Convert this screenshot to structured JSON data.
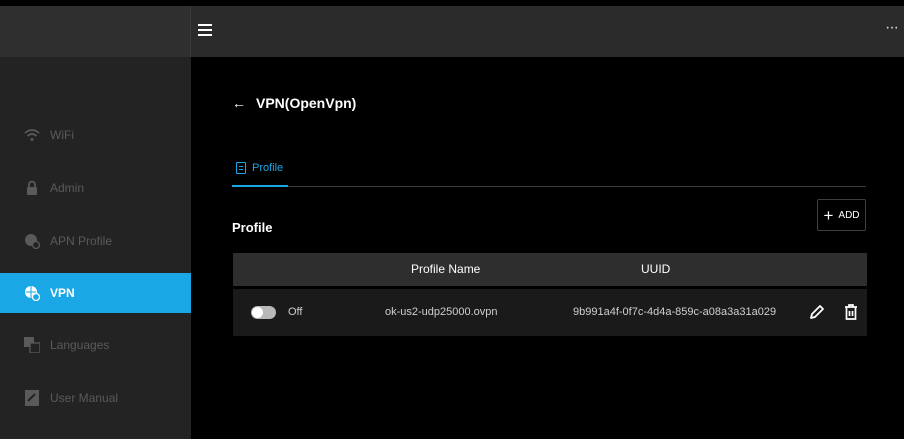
{
  "topbar": {
    "menu_icon": "hamburger-menu-icon",
    "more_icon": "more-options-icon",
    "more_glyph": "···"
  },
  "sidebar": {
    "items": [
      {
        "label": "WiFi",
        "icon": "wifi-icon"
      },
      {
        "label": "Admin",
        "icon": "lock-icon"
      },
      {
        "label": "APN Profile",
        "icon": "apn-profile-icon"
      },
      {
        "label": "VPN",
        "icon": "vpn-icon",
        "active": true
      },
      {
        "label": "Languages",
        "icon": "languages-icon"
      },
      {
        "label": "User Manual",
        "icon": "user-manual-icon"
      }
    ]
  },
  "page": {
    "back_glyph": "←",
    "title": "VPN(OpenVpn)"
  },
  "tabs": [
    {
      "label": "Profile",
      "icon": "document-icon",
      "active": true
    }
  ],
  "section": {
    "title": "Profile",
    "add_label": "ADD",
    "add_glyph": "+"
  },
  "table": {
    "headers": [
      "",
      "Profile Name",
      "UUID",
      ""
    ],
    "rows": [
      {
        "toggle_state": "Off",
        "profile_name": "ok-us2-udp25000.ovpn",
        "uuid": "9b991a4f-0f7c-4d4a-859c-a08a3a31a029"
      }
    ]
  },
  "colors": {
    "accent": "#1aa7e6",
    "background": "#000000",
    "sidebar": "#232323",
    "topbar": "#2b2b2b"
  }
}
